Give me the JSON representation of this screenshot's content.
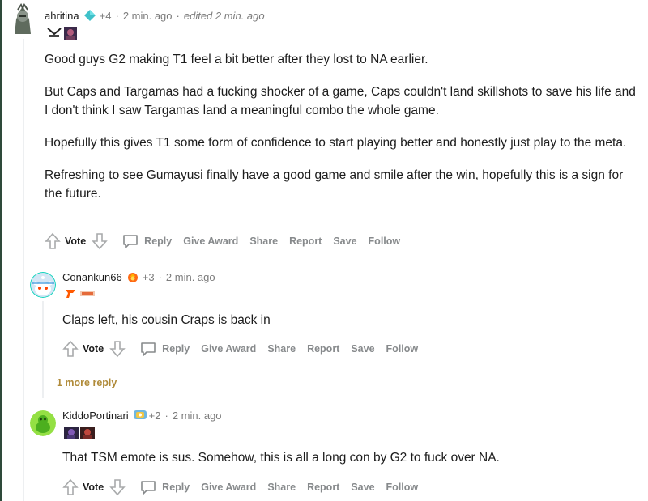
{
  "comments": [
    {
      "author": "ahritina",
      "karma": "+4",
      "time": "2 min. ago",
      "edited": "edited 2 min. ago",
      "paragraphs": [
        "Good guys G2 making T1 feel a bit better after they lost to NA earlier.",
        "But Caps and Targamas had a fucking shocker of a game, Caps couldn't land skillshots to save his life and I don't think I saw Targamas land a meaningful combo the whole game.",
        "Hopefully this gives T1 some form of confidence to start playing better and honestly just play to the meta.",
        "Refreshing to see Gumayusi finally have a good game and smile after the win, hopefully this is a sign for the future."
      ]
    },
    {
      "author": "Conankun66",
      "karma": "+3",
      "time": "2 min. ago",
      "paragraphs": [
        "Claps left, his cousin Craps is back in"
      ]
    },
    {
      "author": "KiddoPortinari",
      "karma": "+2",
      "time": "2 min. ago",
      "paragraphs": [
        "That TSM emote is sus. Somehow, this is all a long con by G2 to fuck over NA."
      ]
    }
  ],
  "actions": {
    "vote": "Vote",
    "reply": "Reply",
    "give_award": "Give Award",
    "share": "Share",
    "report": "Report",
    "save": "Save",
    "follow": "Follow"
  },
  "more_reply": "1 more reply",
  "separator": "·",
  "colors": {
    "accent_left_bar": "#2e4a3a",
    "action_text": "#878a8c",
    "more_reply": "#b08b3a"
  }
}
